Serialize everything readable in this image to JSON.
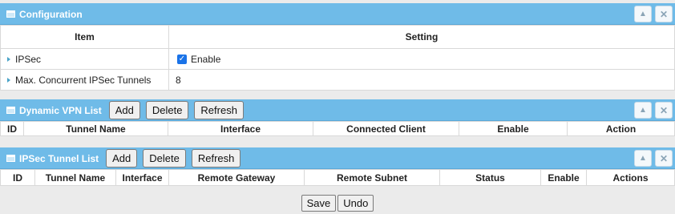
{
  "configuration": {
    "title": "Configuration",
    "columns": {
      "item": "Item",
      "setting": "Setting"
    },
    "rows": [
      {
        "label": "IPSec",
        "value": "Enable",
        "checked": true
      },
      {
        "label": "Max. Concurrent IPSec Tunnels",
        "value": "8"
      }
    ]
  },
  "dynamic_vpn": {
    "title": "Dynamic VPN List",
    "buttons": {
      "add": "Add",
      "delete": "Delete",
      "refresh": "Refresh"
    },
    "columns": [
      "ID",
      "Tunnel Name",
      "Interface",
      "Connected Client",
      "Enable",
      "Action"
    ]
  },
  "ipsec_tunnels": {
    "title": "IPSec Tunnel List",
    "buttons": {
      "add": "Add",
      "delete": "Delete",
      "refresh": "Refresh"
    },
    "columns": [
      "ID",
      "Tunnel Name",
      "Interface",
      "Remote Gateway",
      "Remote Subnet",
      "Status",
      "Enable",
      "Actions"
    ]
  },
  "panel_controls": {
    "collapse_icon": "triangle-up-icon",
    "close_icon": "close-icon"
  },
  "footer": {
    "save": "Save",
    "undo": "Undo"
  },
  "colors": {
    "panel_header": "#6fbbe8",
    "background": "#ebebeb",
    "checkbox": "#1a73e8"
  }
}
